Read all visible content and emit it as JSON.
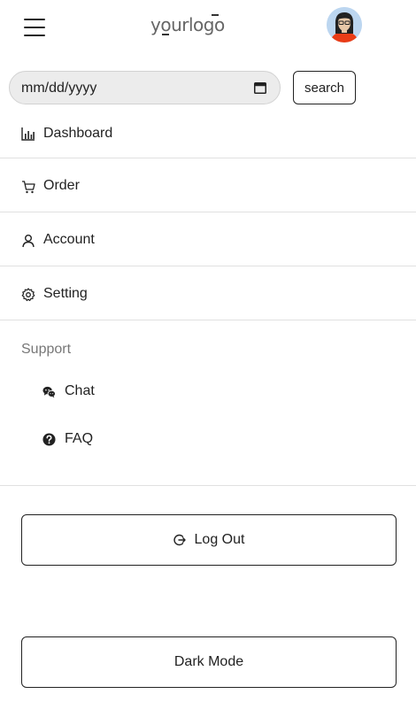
{
  "header": {
    "logo_text": "yourlogo",
    "menu_icon": "hamburger-icon",
    "avatar_icon": "avatar-icon"
  },
  "search": {
    "date_placeholder": "mm/dd/yyyy",
    "calendar_icon": "calendar-icon",
    "button_label": "search"
  },
  "nav": {
    "items": [
      {
        "label": "Dashboard",
        "icon": "bar-chart-icon"
      },
      {
        "label": "Order",
        "icon": "cart-icon"
      },
      {
        "label": "Account",
        "icon": "user-icon"
      },
      {
        "label": "Setting",
        "icon": "gear-icon"
      }
    ]
  },
  "support": {
    "heading": "Support",
    "items": [
      {
        "label": "Chat",
        "icon": "chat-icon"
      },
      {
        "label": "FAQ",
        "icon": "question-icon"
      }
    ]
  },
  "actions": {
    "logout_label": "Log Out",
    "logout_icon": "logout-icon",
    "dark_mode_label": "Dark Mode"
  },
  "colors": {
    "text": "#222222",
    "muted": "#777777",
    "divider": "#e0e0e0",
    "input_bg": "#ececec"
  }
}
